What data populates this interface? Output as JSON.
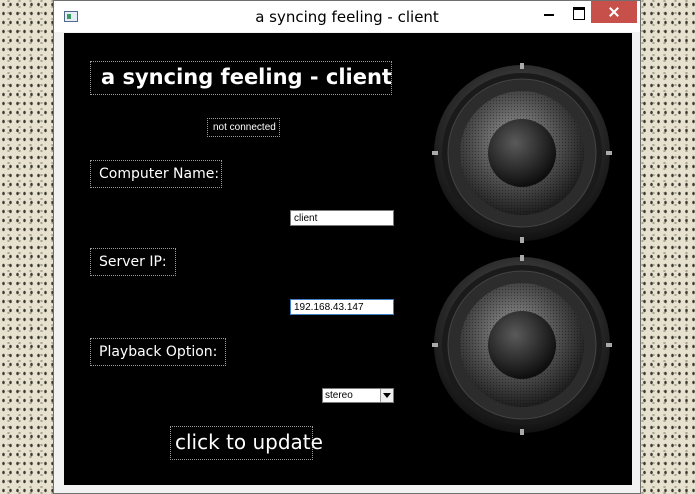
{
  "window": {
    "title": "a syncing feeling - client"
  },
  "app": {
    "heading": "a syncing feeling - client",
    "status": "not connected"
  },
  "form": {
    "computer_name_label": "Computer Name:",
    "computer_name_value": "client",
    "server_ip_label": "Server IP:",
    "server_ip_value": "192.168.43.147",
    "playback_label": "Playback Option:",
    "playback_selected": "stereo"
  },
  "actions": {
    "update_label": "click to update"
  },
  "icons": {
    "speakers": [
      "speaker-icon",
      "speaker-icon"
    ]
  },
  "colors": {
    "client_bg": "#000000",
    "close_button": "#c7504b",
    "label_text": "#ffffff"
  }
}
